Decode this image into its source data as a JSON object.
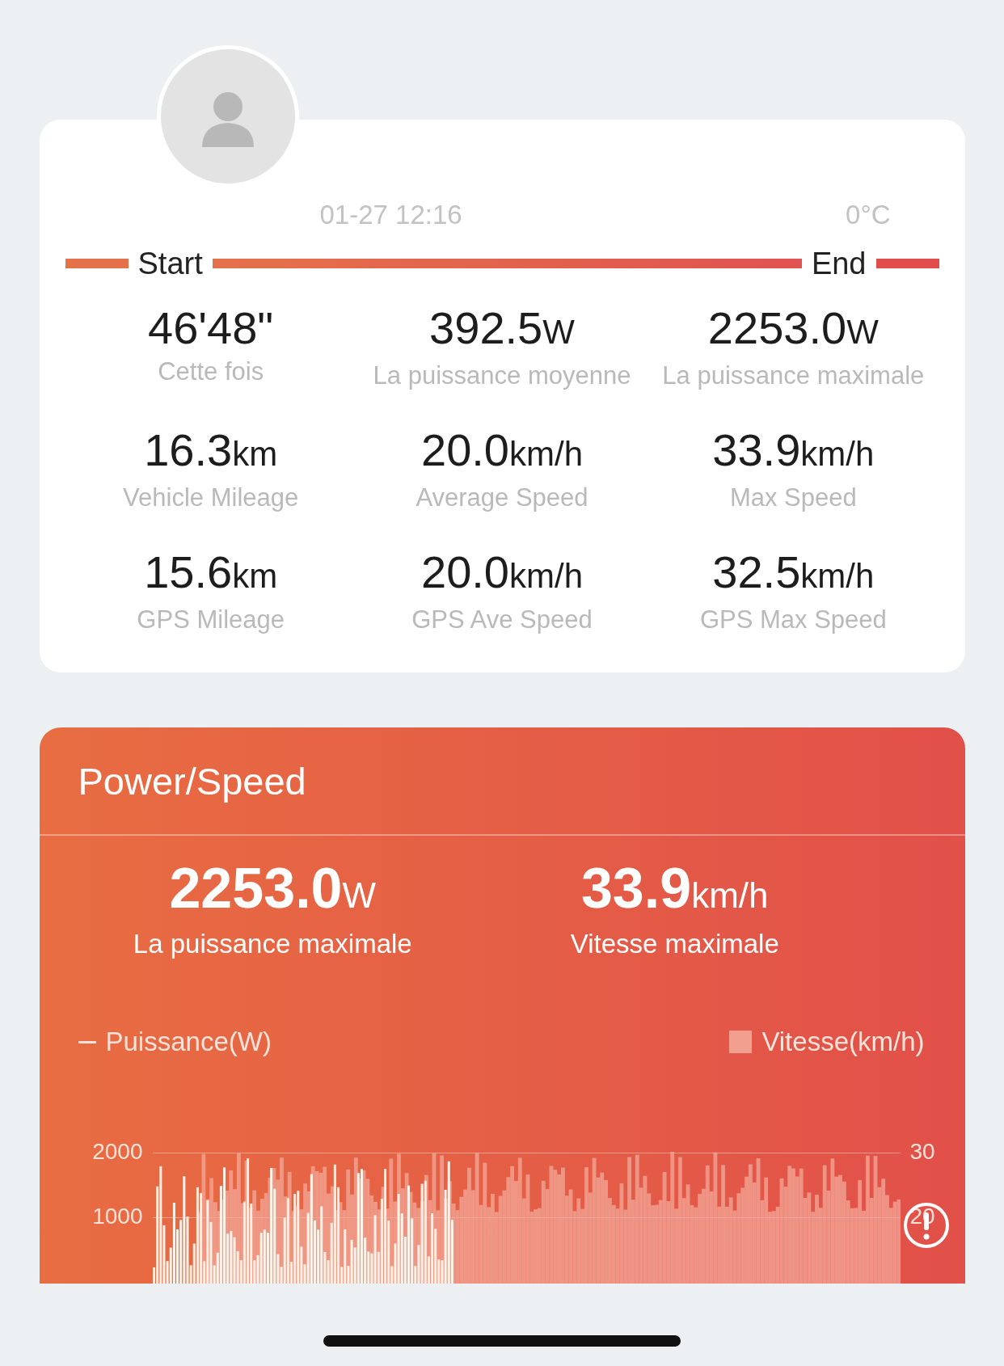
{
  "ride": {
    "date": "01-27 12:16",
    "temperature": "0°C",
    "start_label": "Start",
    "end_label": "End"
  },
  "stats": [
    {
      "value": "46'48\"",
      "label": "Cette fois"
    },
    {
      "value": "392.5",
      "unit": "W",
      "label": "La puissance moyenne"
    },
    {
      "value": "2253.0",
      "unit": "W",
      "label": "La puissance maximale"
    },
    {
      "value": "16.3",
      "unit": "km",
      "label": "Vehicle Mileage"
    },
    {
      "value": "20.0",
      "unit": "km/h",
      "label": "Average Speed"
    },
    {
      "value": "33.9",
      "unit": "km/h",
      "label": "Max Speed"
    },
    {
      "value": "15.6",
      "unit": "km",
      "label": "GPS Mileage"
    },
    {
      "value": "20.0",
      "unit": "km/h",
      "label": "GPS Ave Speed"
    },
    {
      "value": "32.5",
      "unit": "km/h",
      "label": "GPS Max Speed"
    }
  ],
  "power_speed": {
    "title": "Power/Speed",
    "highlights": [
      {
        "value": "2253.0",
        "unit": "W",
        "label": "La puissance maximale"
      },
      {
        "value": "33.9",
        "unit": "km/h",
        "label": "Vitesse maximale"
      }
    ],
    "legend": [
      {
        "kind": "line",
        "label": "Puissance(W)"
      },
      {
        "kind": "square",
        "label": "Vitesse(km/h)"
      }
    ],
    "left_axis": [
      "2000",
      "1000"
    ],
    "right_axis": [
      "30",
      "20"
    ]
  }
}
